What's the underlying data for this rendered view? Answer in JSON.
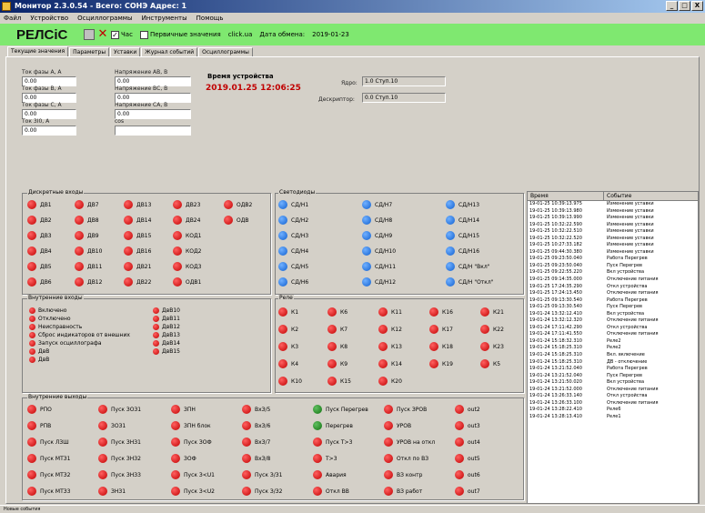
{
  "window": {
    "title": "Монитор 2.3.0.54 - Всего: СОНЭ Адрес: 1",
    "min": "_",
    "max": "□",
    "close": "X"
  },
  "menu": [
    "Файл",
    "Устройство",
    "Осциллограммы",
    "Инструменты",
    "Помощь"
  ],
  "toolbar": {
    "brand": "РЕЛСiС",
    "opt1": "Час",
    "opt2": "Первичные значения",
    "status": "click.ua",
    "date_label": "Дата обмена:",
    "date": "2019-01-23"
  },
  "tabs": [
    "Текущие значения",
    "Параметры",
    "Уставки",
    "Журнал событий",
    "Осциллограммы"
  ],
  "measurements": [
    {
      "label": "Ток фазы А, А",
      "value": "0.00"
    },
    {
      "label": "Напряжение АВ, В",
      "value": "0.00"
    },
    {
      "label": "Ток фазы В, А",
      "value": "0.00"
    },
    {
      "label": "Напряжение ВС, В",
      "value": "0.00"
    },
    {
      "label": "Ток фазы С, А",
      "value": "0.00"
    },
    {
      "label": "Напряжение СА, В",
      "value": "0.00"
    },
    {
      "label": "Ток 3I0, А",
      "value": "0.00"
    },
    {
      "label": "cos",
      "value": ""
    }
  ],
  "clock": {
    "label": "Время устройства",
    "value": "2019.01.25 12:06:25"
  },
  "info": {
    "id_label": "Ядро:",
    "id_value": "1.0 Ступ.10",
    "dev_label": "Дескриптор:",
    "dev_value": "0.0 Ступ.10"
  },
  "discrete_inputs": {
    "title": "Дискретные входы",
    "items": [
      "ДВ1",
      "ДВ7",
      "ДВ13",
      "ДВ23",
      "ОДВ2",
      "ДВ2",
      "ДВ8",
      "ДВ14",
      "ДВ24",
      "ОДВ",
      "ДВ3",
      "ДВ9",
      "ДВ15",
      "КОД1",
      "ДВ4",
      "ДВ10",
      "ДВ16",
      "КОД2",
      "ДВ5",
      "ДВ11",
      "ДВ21",
      "КОД3",
      "ДВ6",
      "ДВ12",
      "ДВ22",
      "ОДВ1"
    ]
  },
  "leds": {
    "title": "Светодиоды",
    "items": [
      "СД/Н1",
      "СД/Н7",
      "СД/Н13",
      "СД/Н2",
      "СД/Н8",
      "СД/Н14",
      "СД/Н3",
      "СД/Н9",
      "СД/Н15",
      "СД/Н4",
      "СД/Н10",
      "СД/Н16",
      "СД/Н5",
      "СД/Н11",
      "СД/Н \"Вкл\"",
      "СД/Н6",
      "СД/Н12",
      "СД/Н \"Откл\""
    ]
  },
  "internal_signals": {
    "title": "Внутренние входы",
    "left": [
      "Включено",
      "Отключено",
      "Неисправность",
      "Сброс индикаторов от внешних",
      "Запуск осциллографа",
      "ДвВ",
      "ДвВ"
    ],
    "right": [
      "ДвВ10",
      "ДвВ11",
      "ДвВ12",
      "ДвВ13",
      "ДвВ14",
      "ДвВ15"
    ]
  },
  "relays": {
    "title": "Реле",
    "items": [
      "К1",
      "К6",
      "К11",
      "К16",
      "К21",
      "К2",
      "К7",
      "К12",
      "К17",
      "К22",
      "К3",
      "К8",
      "К13",
      "К18",
      "К23",
      "К4",
      "К9",
      "К14",
      "К19",
      "К5",
      "К10",
      "К15",
      "К20"
    ]
  },
  "outputs": {
    "title": "Внутренние выходы",
    "items": [
      {
        "t": "РПО",
        "c": "red"
      },
      {
        "t": "Пуск ЗОЗ1",
        "c": "red"
      },
      {
        "t": "ЗПН",
        "c": "red"
      },
      {
        "t": "ВхЗ/5",
        "c": "red"
      },
      {
        "t": "Пуск Перегрев",
        "c": "green"
      },
      {
        "t": "Пуск ЗРОВ",
        "c": "red"
      },
      {
        "t": "out2",
        "c": "red"
      },
      {
        "t": "РПВ",
        "c": "red"
      },
      {
        "t": "ЗОЗ1",
        "c": "red"
      },
      {
        "t": "ЗПН блок",
        "c": "red"
      },
      {
        "t": "ВхЗ/6",
        "c": "red"
      },
      {
        "t": "Перегрев",
        "c": "green"
      },
      {
        "t": "УРОВ",
        "c": "red"
      },
      {
        "t": "out3",
        "c": "red"
      },
      {
        "t": "Пуск ЛЗШ",
        "c": "red"
      },
      {
        "t": "Пуск ЗНЗ1",
        "c": "red"
      },
      {
        "t": "Пуск ЗОФ",
        "c": "red"
      },
      {
        "t": "ВхЗ/7",
        "c": "red"
      },
      {
        "t": "Пуск Т>3",
        "c": "red"
      },
      {
        "t": "УРОВ на откл",
        "c": "red"
      },
      {
        "t": "out4",
        "c": "red"
      },
      {
        "t": "Пуск МТЗ1",
        "c": "red"
      },
      {
        "t": "Пуск ЗНЗ2",
        "c": "red"
      },
      {
        "t": "ЗОФ",
        "c": "red"
      },
      {
        "t": "ВхЗ/8",
        "c": "red"
      },
      {
        "t": "Т>3",
        "c": "red"
      },
      {
        "t": "Откл по ВЗ",
        "c": "red"
      },
      {
        "t": "out5",
        "c": "red"
      },
      {
        "t": "Пуск МТЗ2",
        "c": "red"
      },
      {
        "t": "Пуск ЗНЗ3",
        "c": "red"
      },
      {
        "t": "Пуск З<U1",
        "c": "red"
      },
      {
        "t": "Пуск З/З1",
        "c": "red"
      },
      {
        "t": "Авария",
        "c": "red"
      },
      {
        "t": "ВЗ контр",
        "c": "red"
      },
      {
        "t": "out6",
        "c": "red"
      },
      {
        "t": "Пуск МТЗ3",
        "c": "red"
      },
      {
        "t": "ЗНЗ1",
        "c": "red"
      },
      {
        "t": "Пуск З<U2",
        "c": "red"
      },
      {
        "t": "Пуск З/З2",
        "c": "red"
      },
      {
        "t": "Откл ВВ",
        "c": "red"
      },
      {
        "t": "ВЗ работ",
        "c": "red"
      },
      {
        "t": "out7",
        "c": "red"
      }
    ]
  },
  "events": {
    "col1": "Время",
    "col2": "Событие",
    "rows": [
      [
        "19-01-25 10:39:13.975",
        "Изменение уставки"
      ],
      [
        "19-01-25 10:39:13.980",
        "Изменение уставки"
      ],
      [
        "19-01-25 10:39:13.990",
        "Изменение уставки"
      ],
      [
        "19-01-25 10:32:22.590",
        "Изменение уставки"
      ],
      [
        "19-01-25 10:32:22.510",
        "Изменение уставки"
      ],
      [
        "19-01-25 10:32:22.520",
        "Изменение уставки"
      ],
      [
        "19-01-25 10:27:33.182",
        "Изменение уставки"
      ],
      [
        "19-01-25 09:44:30.380",
        "Изменение уставки"
      ],
      [
        "19-01-25 09:23:50.040",
        "Работа Перегрев"
      ],
      [
        "19-01-25 09:23:50.040",
        "Пуск Перегрев"
      ],
      [
        "19-01-25 09:22:55.220",
        "Вкл устройства"
      ],
      [
        "19-01-25 09:14:35.000",
        "Отключение питания"
      ],
      [
        "19-01-25 17:24:35.290",
        "Откл устройства"
      ],
      [
        "19-01-25 17:24:13.450",
        "Отключение питания"
      ],
      [
        "19-01-25 09:13:30.540",
        "Работа Перегрев"
      ],
      [
        "19-01-25 09:13:30.540",
        "Пуск Перегрев"
      ],
      [
        "19-01-24 13:32:12.410",
        "Вкл устройства"
      ],
      [
        "19-01-24 13:32:12.320",
        "Отключение питания"
      ],
      [
        "19-01-24 17:11:42.290",
        "Откл устройства"
      ],
      [
        "19-01-24 17:11:41.550",
        "Отключение питания"
      ],
      [
        "19-01-24 15:18:32.310",
        "Реле2"
      ],
      [
        "19-01-24 15:18:25.310",
        "Реле2"
      ],
      [
        "19-01-24 15:18:25.310",
        "Вкл. включение"
      ],
      [
        "19-01-24 15:18:25.310",
        "ДВ - отключение"
      ],
      [
        "19-01-24 13:21:52.040",
        "Работа Перегрев"
      ],
      [
        "19-01-24 13:21:52.040",
        "Пуск Перегрев"
      ],
      [
        "19-01-24 13:21:50.020",
        "Вкл устройства"
      ],
      [
        "19-01-24 13:21:52.000",
        "Отключение питания"
      ],
      [
        "19-01-24 13:26:33.140",
        "Откл устройства"
      ],
      [
        "19-01-24 13:26:33.100",
        "Отключение питания"
      ],
      [
        "19-01-24 13:28:22.410",
        "Реле6"
      ],
      [
        "19-01-24 13:28:13.410",
        "Реле1"
      ]
    ]
  },
  "statusbar": "Новые события"
}
